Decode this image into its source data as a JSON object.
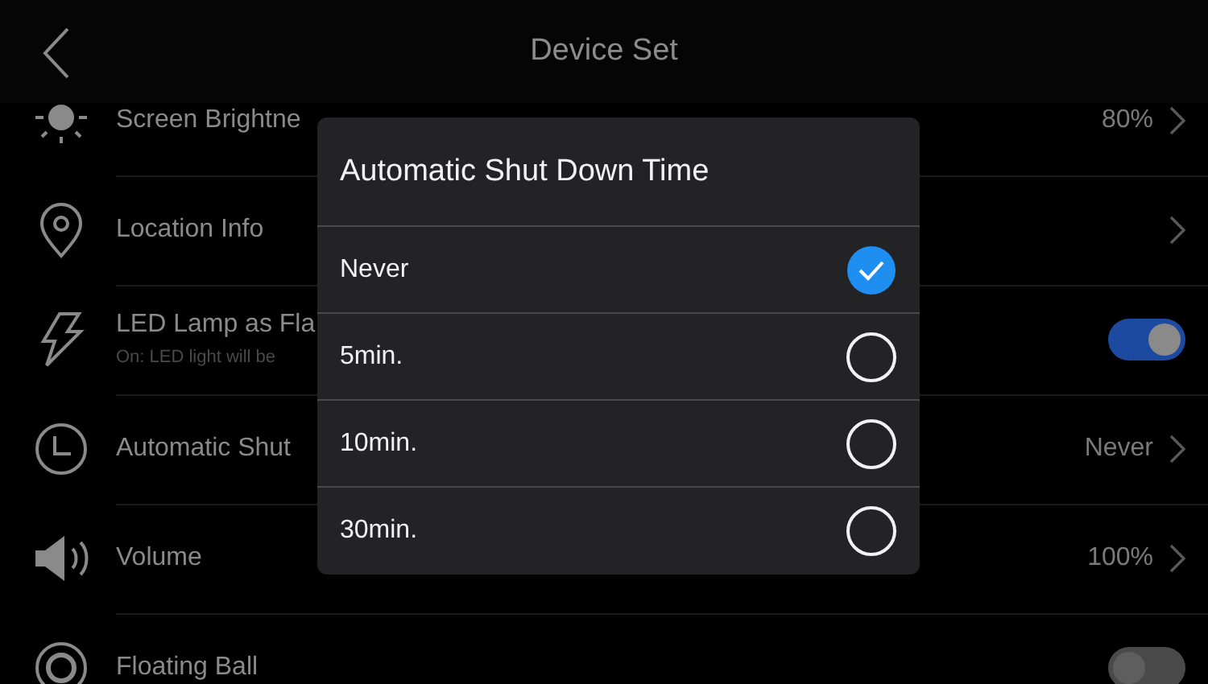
{
  "header": {
    "title": "Device Set"
  },
  "settings": [
    {
      "kind": "nav",
      "label": "Screen Brightne",
      "value": "80%"
    },
    {
      "kind": "nav",
      "label": "Location Info"
    },
    {
      "kind": "toggle",
      "label": "LED Lamp as Fla",
      "subtitle": "On: LED light will be",
      "on": true
    },
    {
      "kind": "nav",
      "label": "Automatic Shut",
      "value": "Never"
    },
    {
      "kind": "nav",
      "label": "Volume",
      "value": "100%"
    },
    {
      "kind": "toggle",
      "label": "Floating Ball",
      "on": false
    }
  ],
  "dialog": {
    "title": "Automatic Shut Down Time",
    "options": [
      {
        "label": "Never",
        "selected": true
      },
      {
        "label": "5min.",
        "selected": false
      },
      {
        "label": "10min.",
        "selected": false
      },
      {
        "label": "30min.",
        "selected": false
      }
    ]
  }
}
